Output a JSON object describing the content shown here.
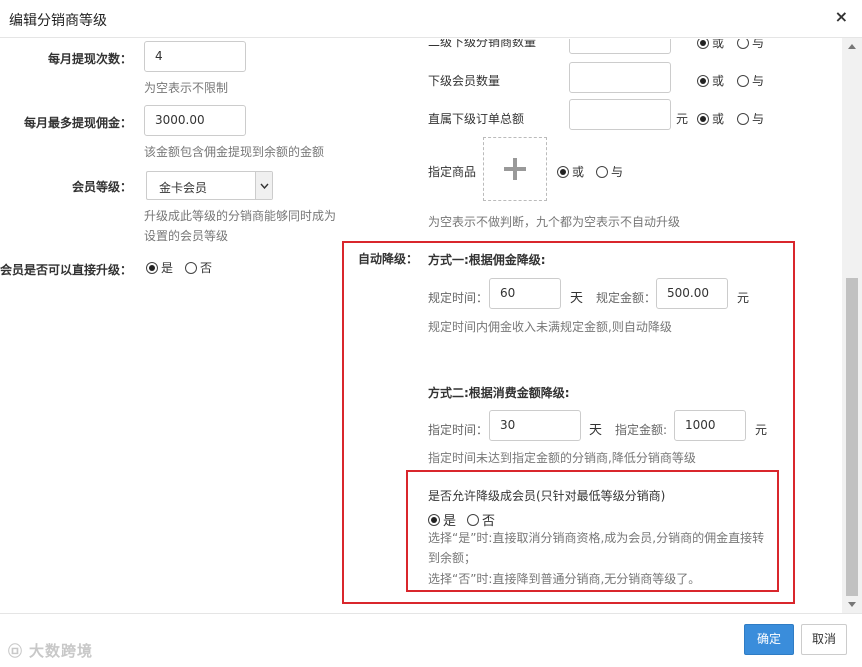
{
  "dialog": {
    "title": "编辑分销商等级",
    "close_icon": "×"
  },
  "left": {
    "withdraw_count": {
      "label": "每月提现次数：",
      "value": "4",
      "help": "为空表示不限制"
    },
    "withdraw_max": {
      "label": "每月最多提现佣金：",
      "value": "3000.00",
      "help": "该金额包含佣金提现到余额的金额"
    },
    "member_level": {
      "label": "会员等级：",
      "value": "金卡会员",
      "help1": "升级成此等级的分销商能够同时成为",
      "help2": "设置的会员等级"
    },
    "direct_upgrade": {
      "label": "会员是否可以直接升级：",
      "yes": "是",
      "no": "否"
    }
  },
  "right": {
    "row0": {
      "label": "二级下级分销商数量",
      "or": "或",
      "and": "与"
    },
    "row1": {
      "label": "下级会员数量",
      "or": "或",
      "and": "与"
    },
    "row2": {
      "label": "直属下级订单总额",
      "unit": "元",
      "or": "或",
      "and": "与"
    },
    "row3": {
      "label": "指定商品",
      "or": "或",
      "and": "与"
    },
    "help": "为空表示不做判断，九个都为空表示不自动升级"
  },
  "downgrade": {
    "label": "自动降级：",
    "method1": {
      "title": "方式一:根据佣金降级:",
      "time_label": "规定时间：",
      "time_value": "60",
      "time_unit": "天",
      "amount_label": "规定金额：",
      "amount_value": "500.00",
      "amount_unit": "元",
      "help": "规定时间内佣金收入未满规定金额,则自动降级"
    },
    "method2": {
      "title": "方式二:根据消费金额降级:",
      "time_label": "指定时间：",
      "time_value": "30",
      "time_unit": "天",
      "amount_label": "指定金额:",
      "amount_value": "1000",
      "amount_unit": "元",
      "help": "指定时间未达到指定金额的分销商,降低分销商等级"
    },
    "allow_member": {
      "title": "是否允许降级成会员(只针对最低等级分销商)",
      "yes": "是",
      "no": "否",
      "help1": "选择“是”时:直接取消分销商资格,成为会员,分销商的佣金直接转",
      "help2": "到余额；",
      "help3": "选择“否”时:直接降到普通分销商,无分销商等级了。"
    }
  },
  "footer": {
    "confirm": "确定",
    "cancel": "取消"
  },
  "watermark": "大数跨境",
  "colors": {
    "primary": "#3a8ddb",
    "highlight_border": "#d9262c"
  }
}
